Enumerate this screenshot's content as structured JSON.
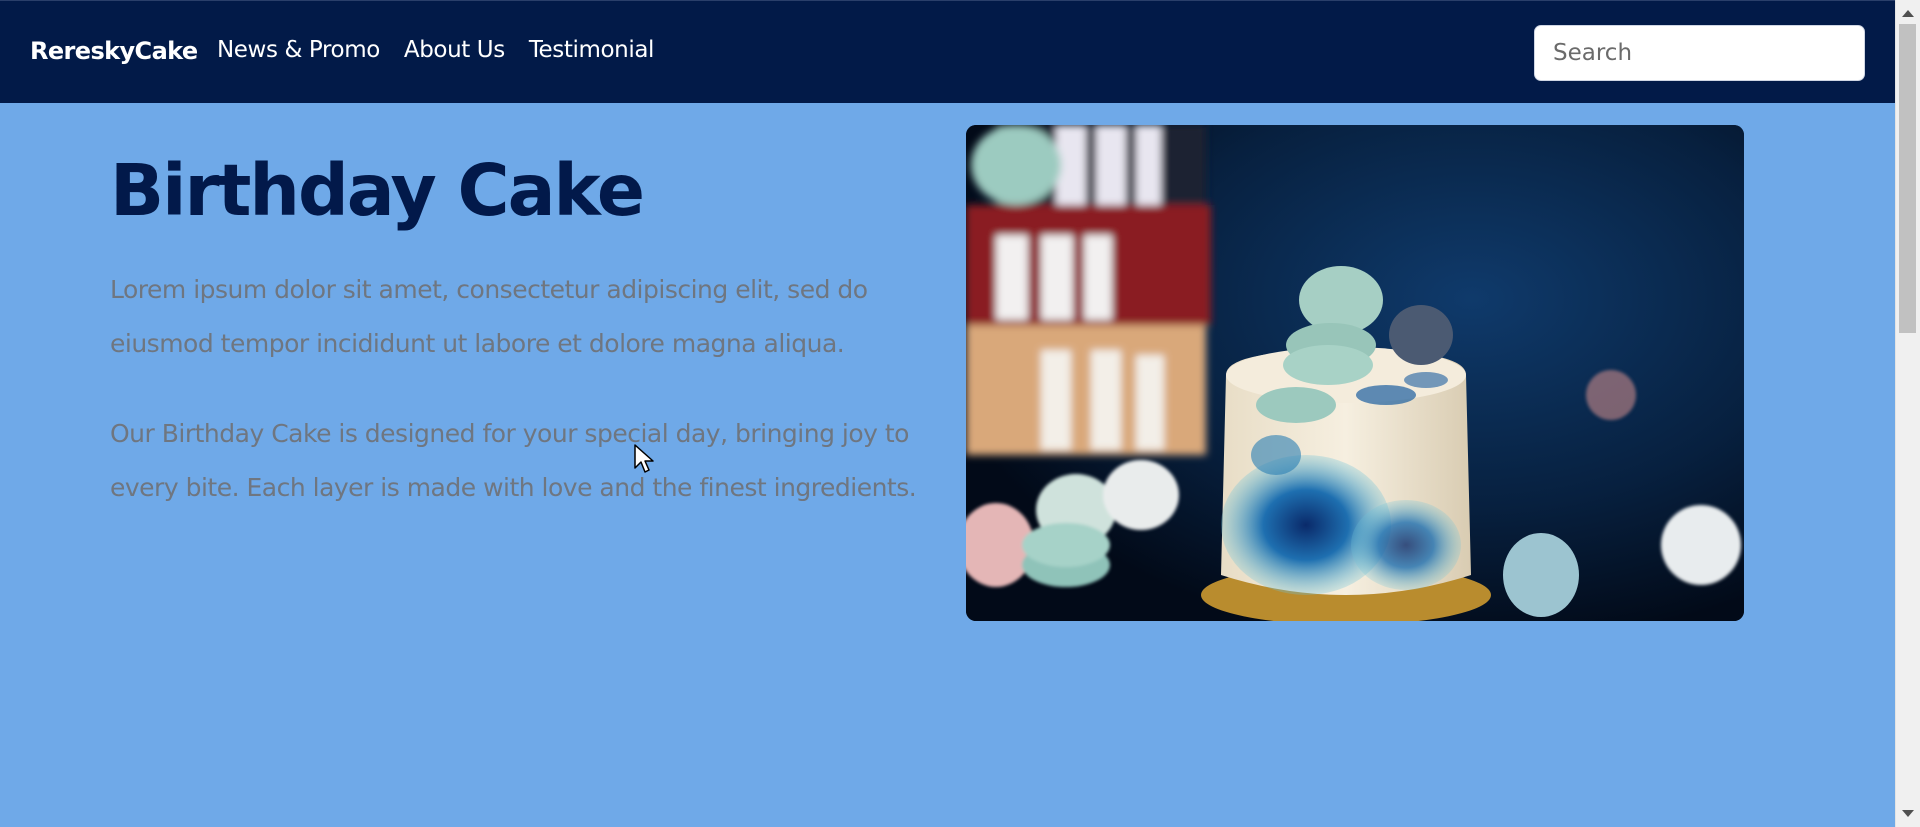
{
  "navbar": {
    "brand": "RereskyCake",
    "links": [
      {
        "label": "News & Promo"
      },
      {
        "label": "About Us"
      },
      {
        "label": "Testimonial"
      }
    ],
    "search": {
      "placeholder": "Search",
      "value": ""
    }
  },
  "hero": {
    "title": "Birthday Cake",
    "paragraphs": [
      "Lorem ipsum dolor sit amet, consectetur adipiscing elit, sed do eiusmod tempor incididunt ut labore et dolore magna aliqua.",
      "Our Birthday Cake is designed for your special day, bringing joy to every bite. Each layer is made with love and the finest ingredients."
    ],
    "image": {
      "subject": "birthday-cake-with-macarons"
    }
  },
  "colors": {
    "navbar_bg": "#021a48",
    "page_bg": "#6fa9e8",
    "title": "#02194a",
    "body_text": "#6f7680"
  }
}
